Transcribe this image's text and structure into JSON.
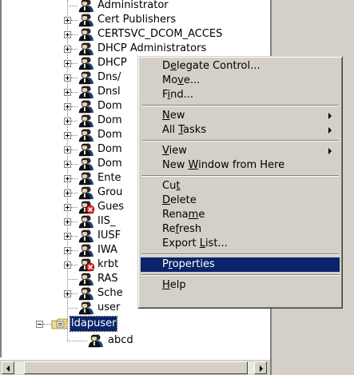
{
  "tree": {
    "items": [
      {
        "label": "Administrator",
        "expander": "none",
        "icon": "group-icon"
      },
      {
        "label": "Cert Publishers",
        "expander": "plus",
        "icon": "group-icon"
      },
      {
        "label": "CERTSVC_DCOM_ACCES",
        "expander": "plus",
        "icon": "group-icon"
      },
      {
        "label": "DHCP Administrators",
        "expander": "plus",
        "icon": "group-icon"
      },
      {
        "label": "DHCP",
        "expander": "plus",
        "icon": "group-icon"
      },
      {
        "label": "Dns/",
        "expander": "plus",
        "icon": "group-icon"
      },
      {
        "label": "Dnsl",
        "expander": "plus",
        "icon": "group-icon"
      },
      {
        "label": "Dom",
        "expander": "plus",
        "icon": "group-icon"
      },
      {
        "label": "Dom",
        "expander": "plus",
        "icon": "group-icon"
      },
      {
        "label": "Dom",
        "expander": "plus",
        "icon": "group-icon"
      },
      {
        "label": "Dom",
        "expander": "plus",
        "icon": "group-icon"
      },
      {
        "label": "Dom",
        "expander": "plus",
        "icon": "group-icon"
      },
      {
        "label": "Ente",
        "expander": "plus",
        "icon": "group-icon"
      },
      {
        "label": "Grou",
        "expander": "plus",
        "icon": "group-icon"
      },
      {
        "label": "Gues",
        "expander": "plus",
        "icon": "disabled-user-icon"
      },
      {
        "label": "IIS_",
        "expander": "plus",
        "icon": "group-icon"
      },
      {
        "label": "IUSF",
        "expander": "plus",
        "icon": "group-icon"
      },
      {
        "label": "IWA",
        "expander": "plus",
        "icon": "group-icon"
      },
      {
        "label": "krbt",
        "expander": "plus",
        "icon": "disabled-user-icon"
      },
      {
        "label": "RAS",
        "expander": "none",
        "icon": "group-icon"
      },
      {
        "label": "Sche",
        "expander": "plus",
        "icon": "group-icon"
      },
      {
        "label": "user",
        "expander": "none",
        "icon": "group-icon"
      }
    ],
    "ou": {
      "label": "ldapuser",
      "expander": "minus",
      "icon": "folder-ou-icon"
    },
    "child": {
      "label": "abcd",
      "icon": "group-icon"
    }
  },
  "context_menu": {
    "items": [
      {
        "label": "Delegate Control...",
        "mnemonic_index": 1,
        "submenu": false
      },
      {
        "label": "Move...",
        "mnemonic_index": 2,
        "submenu": false
      },
      {
        "label": "Find...",
        "mnemonic_index": 1,
        "submenu": false
      },
      {
        "separator": true
      },
      {
        "label": "New",
        "mnemonic_index": 0,
        "submenu": true
      },
      {
        "label": "All Tasks",
        "mnemonic_index": 4,
        "submenu": true
      },
      {
        "separator": true
      },
      {
        "label": "View",
        "mnemonic_index": 0,
        "submenu": true
      },
      {
        "label": "New Window from Here",
        "mnemonic_index": 4,
        "submenu": false
      },
      {
        "separator": true
      },
      {
        "label": "Cut",
        "mnemonic_index": 2,
        "submenu": false
      },
      {
        "label": "Delete",
        "mnemonic_index": 0,
        "submenu": false
      },
      {
        "label": "Rename",
        "mnemonic_index": 4,
        "submenu": false
      },
      {
        "label": "Refresh",
        "mnemonic_index": 2,
        "submenu": false
      },
      {
        "label": "Export List...",
        "mnemonic_index": 7,
        "submenu": false
      },
      {
        "separator": true
      },
      {
        "label": "Properties",
        "mnemonic_index": 1,
        "submenu": false,
        "highlighted": true
      },
      {
        "separator": true
      },
      {
        "label": "Help",
        "mnemonic_index": 0,
        "submenu": false
      }
    ]
  },
  "colors": {
    "highlight": "#0a246a",
    "face": "#d4d0c8"
  }
}
